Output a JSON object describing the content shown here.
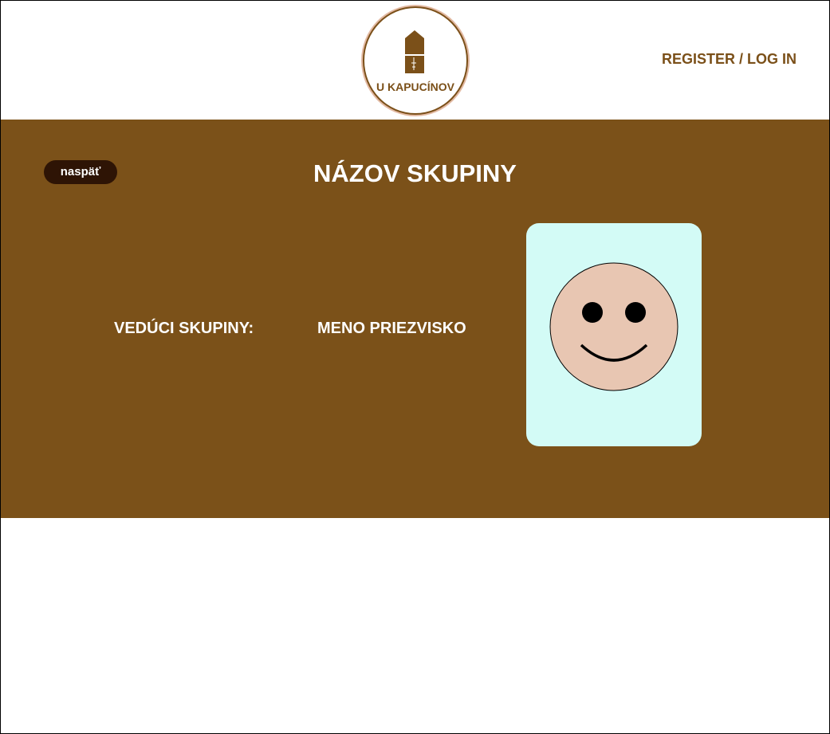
{
  "header": {
    "logo_text": "U KAPUCÍNOV",
    "auth_link": "REGISTER / LOG IN"
  },
  "group": {
    "back_label": "naspäť",
    "title": "NÁZOV SKUPINY",
    "leader_label": "VEDÚCI SKUPINY:",
    "leader_name": "MENO PRIEZVISKO"
  },
  "colors": {
    "brand_brown": "#7b5119",
    "dark_brown": "#2e1405",
    "avatar_bg": "#d3fbf6",
    "face": "#e8c6b2"
  },
  "icons": {
    "logo": "building-icon",
    "avatar": "smiley-face-icon"
  }
}
